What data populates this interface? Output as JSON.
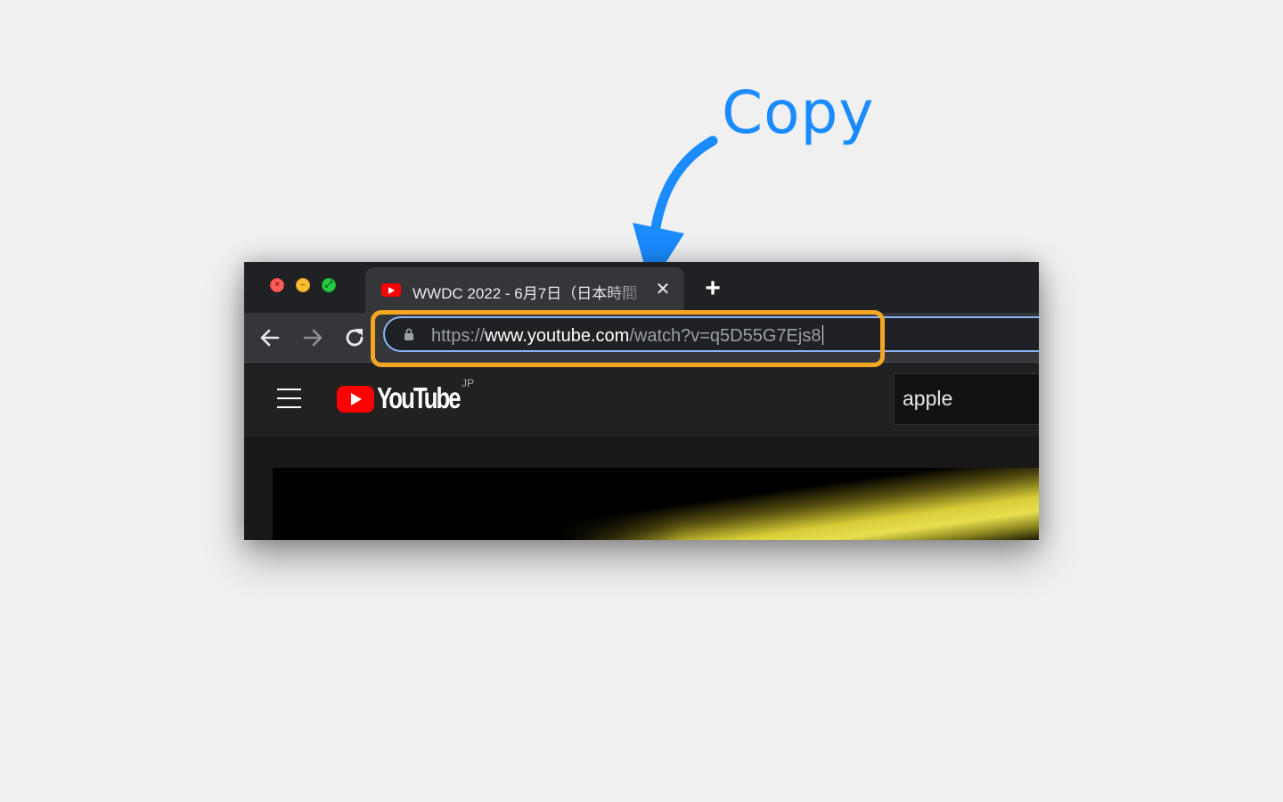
{
  "annotation": {
    "label": "Copy",
    "color": "#1a8cff",
    "highlight_color": "#f5a623"
  },
  "browser": {
    "window_controls": {
      "close_icon": "close-icon",
      "minimize_icon": "minimize-icon",
      "maximize_icon": "fullscreen-icon"
    },
    "tab": {
      "title": "WWDC 2022 - 6月7日（日本時間",
      "favicon": "youtube-favicon-icon",
      "close_glyph": "✕"
    },
    "new_tab_glyph": "+",
    "nav": {
      "back_glyph": "←",
      "forward_glyph": "→",
      "reload_glyph": "↻"
    },
    "address_bar": {
      "scheme": "https://",
      "host": "www.youtube.com",
      "path": "/watch?v=q5D55G7Ejs8",
      "focus_color": "#8ab4f8"
    }
  },
  "youtube": {
    "wordmark": "YouTube",
    "region": "JP",
    "search_value": "apple"
  }
}
